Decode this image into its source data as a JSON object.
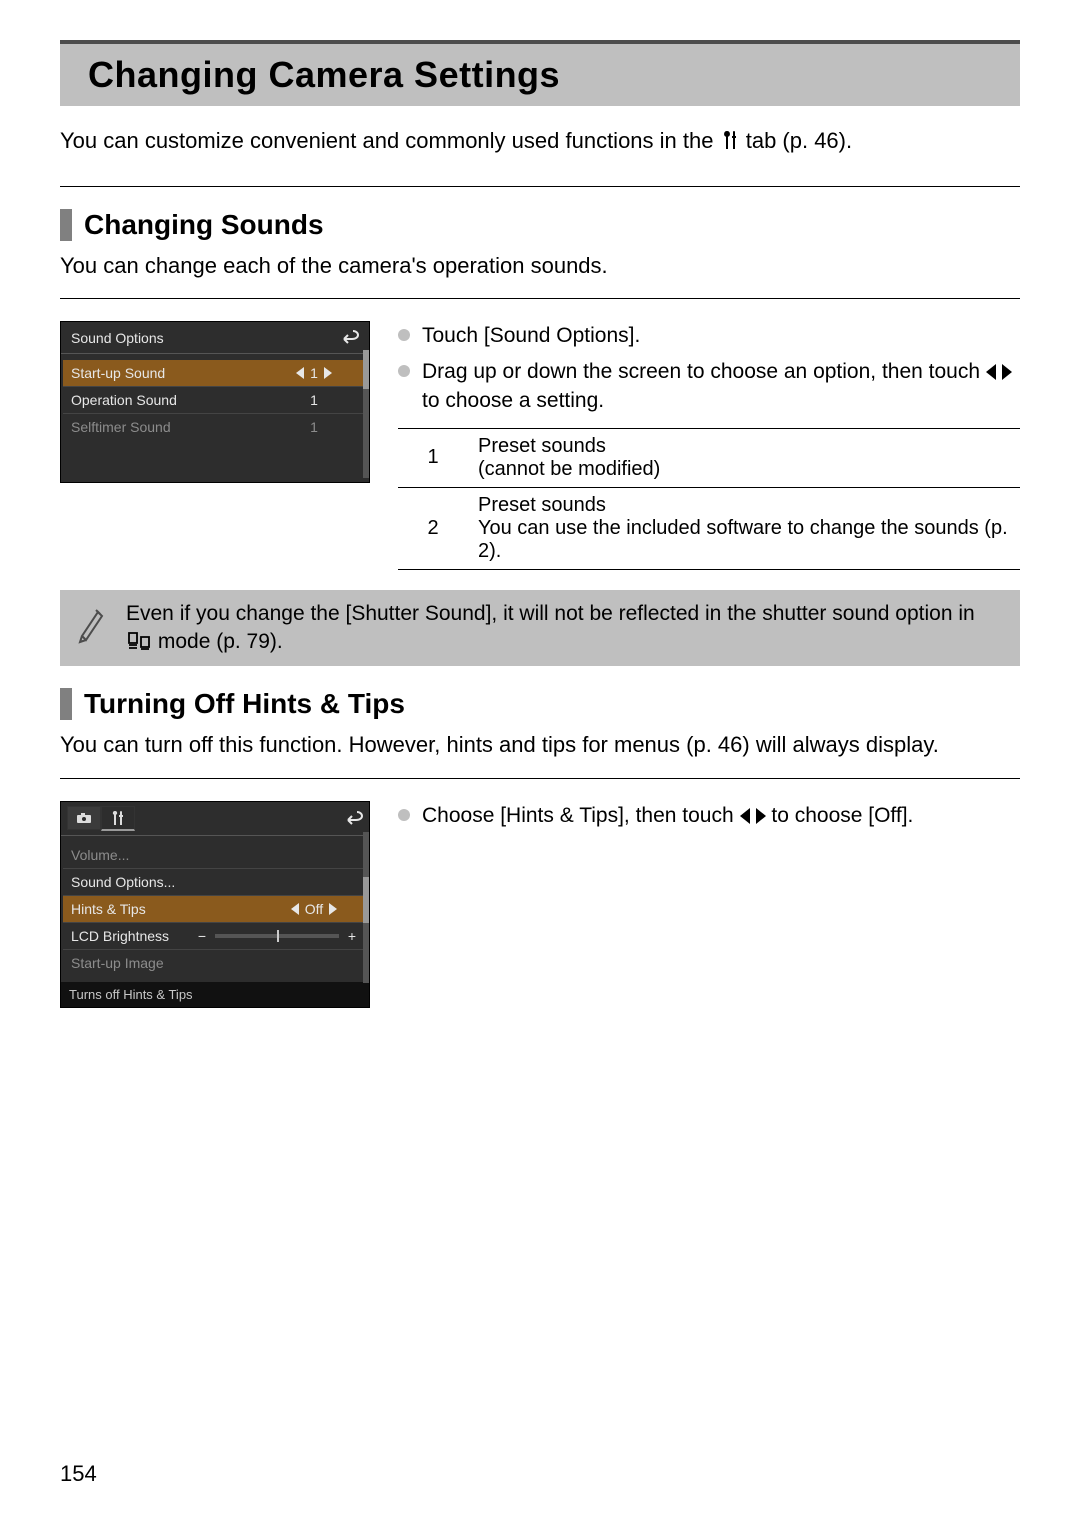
{
  "page_number": "154",
  "title": "Changing Camera Settings",
  "intro_before_icon": "You can customize convenient and commonly used functions in the ",
  "intro_after_icon": " tab (p. 46).",
  "sounds": {
    "heading": "Changing Sounds",
    "desc": "You can change each of the camera's operation sounds.",
    "bullet1": "Touch [Sound Options].",
    "bullet2_a": "Drag up or down the screen to choose an option, then touch ",
    "bullet2_b": " to choose a setting.",
    "table": [
      {
        "k": "1",
        "v": "Preset sounds\n(cannot be modified)"
      },
      {
        "k": "2",
        "v": "Preset sounds\nYou can use the included software to change the sounds (p. 2)."
      }
    ],
    "lcd": {
      "title": "Sound Options",
      "rows": [
        {
          "label": "Start-up Sound",
          "val": "1",
          "sel": true
        },
        {
          "label": "Operation Sound",
          "val": "1",
          "sel": false
        },
        {
          "label": "Selftimer Sound",
          "val": "1",
          "sel": false,
          "dim": true
        }
      ]
    },
    "note_a": "Even if you change the [Shutter Sound], it will not be reflected in the shutter sound option in ",
    "note_b": " mode (p. 79)."
  },
  "hints": {
    "heading": "Turning Off Hints & Tips",
    "desc": "You can turn off this function. However, hints and tips for menus (p. 46) will always display.",
    "bullet_a": "Choose [Hints & Tips], then touch ",
    "bullet_b": " to choose [Off].",
    "lcd": {
      "rows": [
        {
          "label": "Volume...",
          "dim": true
        },
        {
          "label": "Sound Options..."
        },
        {
          "label": "Hints & Tips",
          "val": "Off",
          "sel": true
        },
        {
          "label": "LCD Brightness",
          "slider": true
        },
        {
          "label": "Start-up Image",
          "dim": true
        }
      ],
      "status": "Turns off Hints & Tips"
    }
  }
}
